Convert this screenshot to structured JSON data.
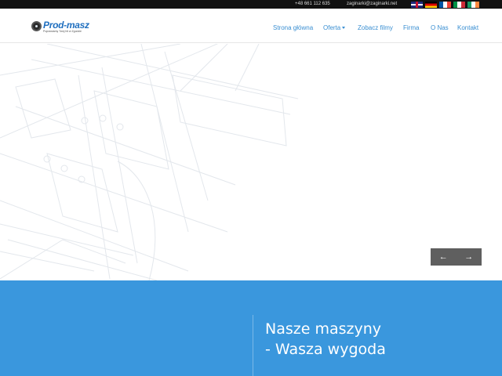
{
  "topbar": {
    "phone": "+48 661 112 635",
    "email": "zaginarki@zaginarki.net",
    "languages": [
      {
        "icon": "flag-uk-icon"
      },
      {
        "icon": "flag-de-icon"
      },
      {
        "icon": "flag-fr-icon"
      },
      {
        "icon": "flag-it-icon"
      },
      {
        "icon": "flag-ie-icon"
      }
    ]
  },
  "header": {
    "logo": {
      "name": "Prod-masz",
      "tagline": "Poprawiamy Twój hit w Zgodzie"
    },
    "nav": [
      {
        "label": "Strona główna"
      },
      {
        "label": "Oferta",
        "has_dropdown": true
      },
      {
        "label": "Zobacz filmy"
      },
      {
        "label": "Firma"
      },
      {
        "label": "O Nas"
      },
      {
        "label": "Kontakt"
      }
    ]
  },
  "slider": {
    "prev_icon": "arrow-left-icon",
    "next_icon": "arrow-right-icon",
    "prev_label": "←",
    "next_label": "→"
  },
  "band": {
    "line1": "Nasze maszyny",
    "line2": "- Wasza wygoda"
  },
  "colors": {
    "accent": "#3a97dd",
    "nav_text": "#3a8fd2",
    "topbar_bg": "#111111",
    "slider_nav_bg": "#5f5f5f"
  }
}
